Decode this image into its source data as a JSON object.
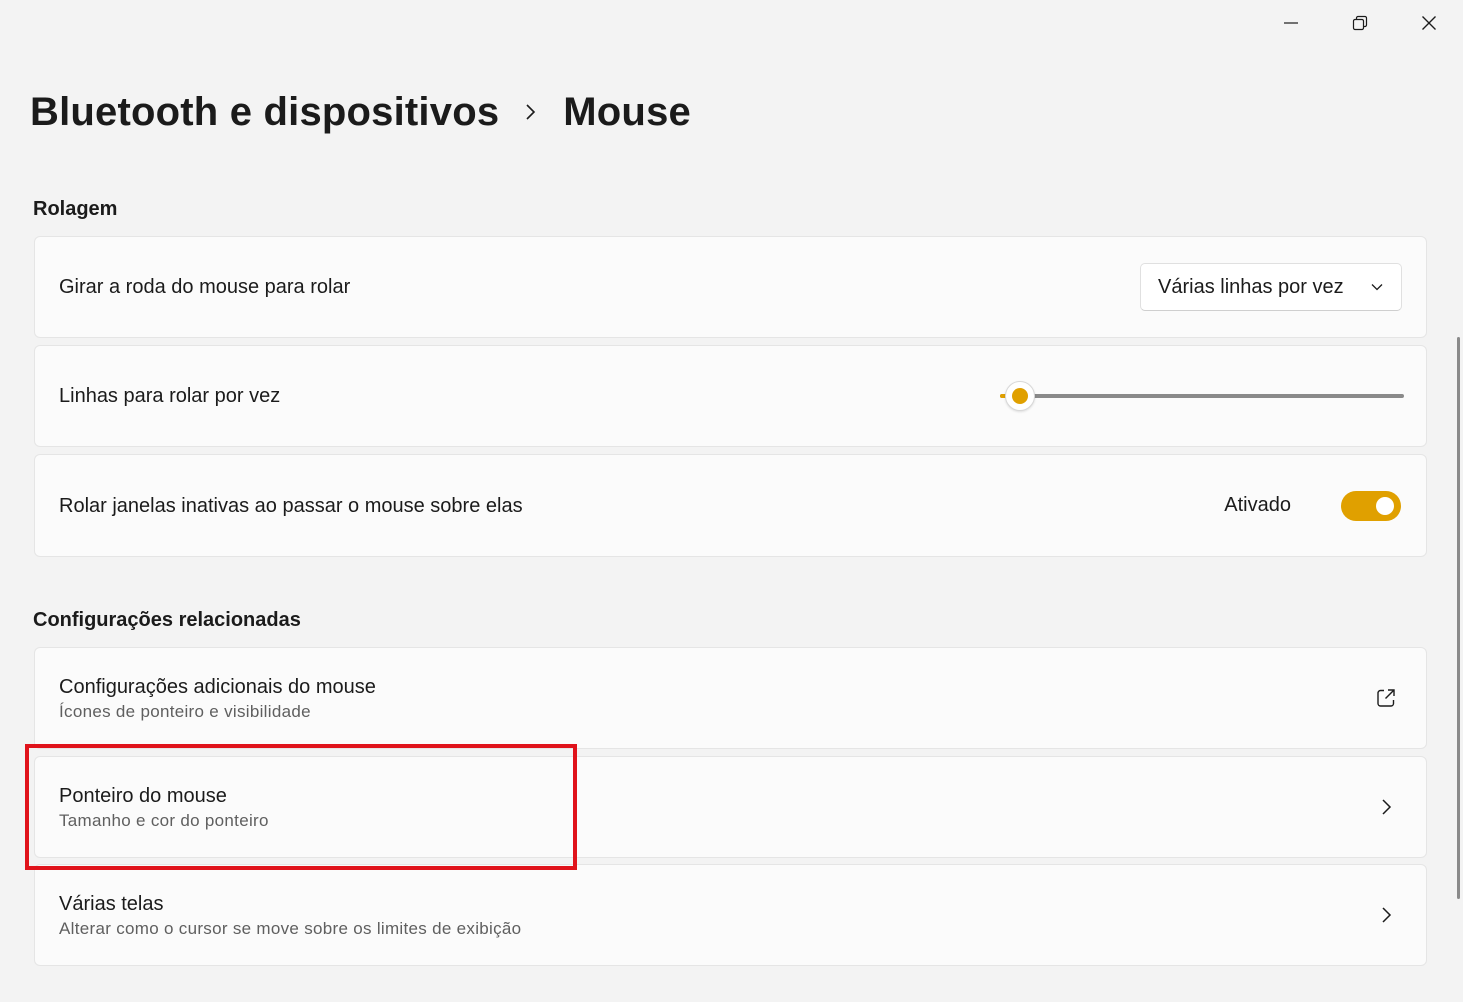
{
  "breadcrumb": {
    "parent": "Bluetooth e dispositivos",
    "current": "Mouse"
  },
  "sections": {
    "scrolling": "Rolagem",
    "related": "Configurações relacionadas"
  },
  "wheel_setting": {
    "title": "Girar a roda do mouse para rolar",
    "value": "Várias linhas por vez"
  },
  "lines_setting": {
    "title": "Linhas para rolar por vez",
    "slider_fraction": 0.05
  },
  "inactive_setting": {
    "title": "Rolar janelas inativas ao passar o mouse sobre elas",
    "state_label": "Ativado",
    "enabled": true
  },
  "related_items": [
    {
      "title": "Configurações adicionais do mouse",
      "subtitle": "Ícones de ponteiro e visibilidade",
      "icon": "open-external-icon"
    },
    {
      "title": "Ponteiro do mouse",
      "subtitle": "Tamanho e cor do ponteiro",
      "icon": "chevron-right-icon"
    },
    {
      "title": "Várias telas",
      "subtitle": "Alterar como o cursor se move sobre os limites de exibição",
      "icon": "chevron-right-icon"
    }
  ],
  "colors": {
    "accent": "#e0a000",
    "highlight": "#e0131b",
    "background": "#f3f3f3",
    "card": "#fbfbfb"
  }
}
